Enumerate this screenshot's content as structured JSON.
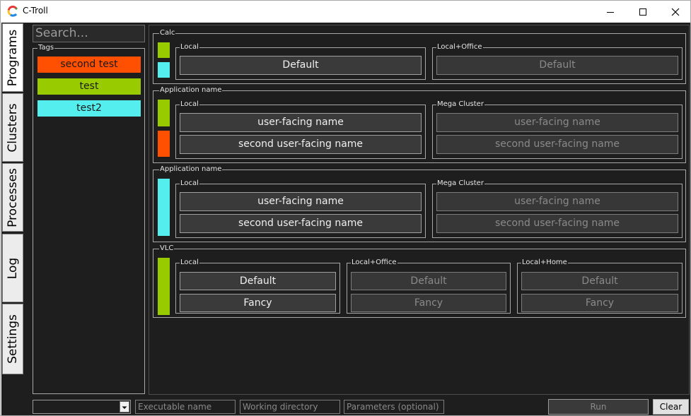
{
  "window": {
    "title": "C-Troll"
  },
  "sidebar_tabs": [
    {
      "label": "Programs"
    },
    {
      "label": "Clusters"
    },
    {
      "label": "Processes"
    },
    {
      "label": "Log"
    },
    {
      "label": "Settings"
    }
  ],
  "search": {
    "placeholder": "Search..."
  },
  "tags": {
    "legend": "Tags",
    "items": [
      {
        "label": "second test",
        "color": "#ff4f00"
      },
      {
        "label": "test",
        "color": "#99cc00"
      },
      {
        "label": "test2",
        "color": "#55eeee"
      }
    ]
  },
  "programs": [
    {
      "name": "Calc",
      "tag_colors": [
        "#99cc00",
        "#55eeee"
      ],
      "clusters": [
        {
          "name": "Local",
          "configs": [
            "Default"
          ]
        },
        {
          "name": "Local+Office",
          "configs": [
            "Default"
          ]
        }
      ]
    },
    {
      "name": "Application name",
      "tag_colors": [
        "#99cc00",
        "#ff4f00"
      ],
      "clusters": [
        {
          "name": "Local",
          "configs": [
            "user-facing name",
            "second user-facing name"
          ]
        },
        {
          "name": "Mega Cluster",
          "configs": [
            "user-facing name",
            "second user-facing name"
          ]
        }
      ]
    },
    {
      "name": "Application name",
      "tag_colors": [
        "#55eeee"
      ],
      "clusters": [
        {
          "name": "Local",
          "configs": [
            "user-facing name",
            "second user-facing name"
          ]
        },
        {
          "name": "Mega Cluster",
          "configs": [
            "user-facing name",
            "second user-facing name"
          ]
        }
      ]
    },
    {
      "name": "VLC",
      "tag_colors": [
        "#99cc00"
      ],
      "clusters": [
        {
          "name": "Local",
          "configs": [
            "Default",
            "Fancy"
          ]
        },
        {
          "name": "Local+Office",
          "configs": [
            "Default",
            "Fancy"
          ]
        },
        {
          "name": "Local+Home",
          "configs": [
            "Default",
            "Fancy"
          ]
        }
      ]
    }
  ],
  "bottom": {
    "executable_placeholder": "Executable name",
    "working_dir_placeholder": "Working directory",
    "parameters_placeholder": "Parameters (optional)",
    "run_label": "Run",
    "clear_label": "Clear"
  }
}
